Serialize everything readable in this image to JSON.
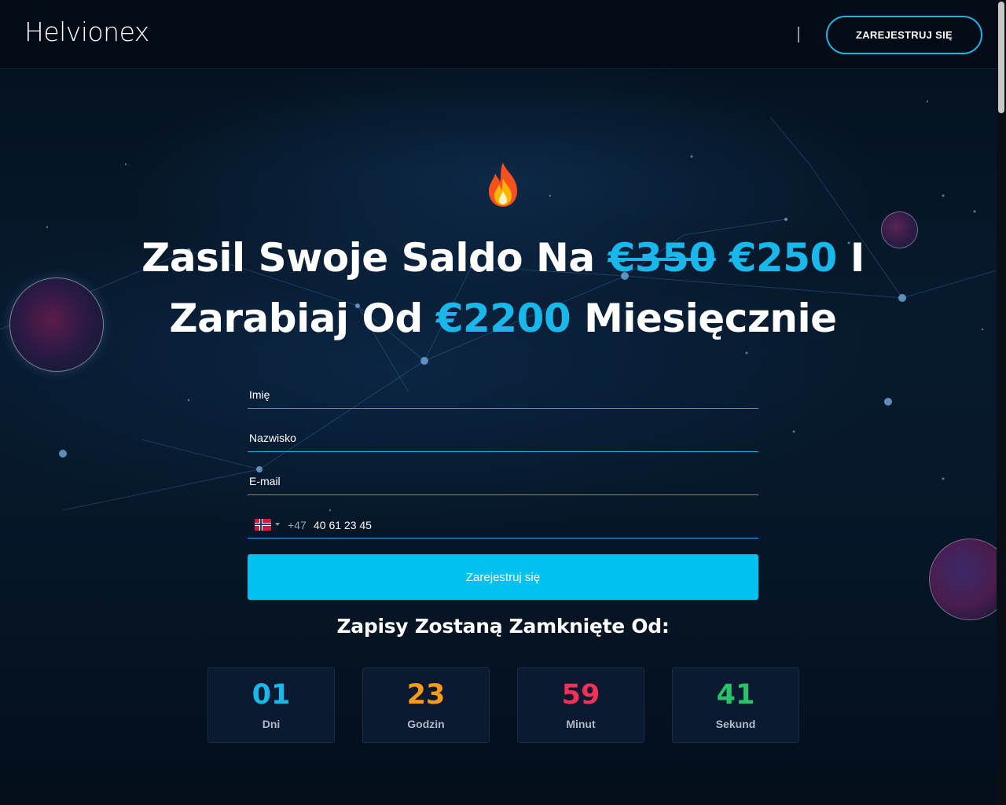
{
  "header": {
    "logo": "Helvionex",
    "cta_label": "ZAREJESTRUJ SIĘ"
  },
  "hero": {
    "icon": "fire-icon",
    "headline": {
      "part1": "Zasil Swoje Saldo Na ",
      "old_price": "€350",
      "space": " ",
      "new_price": "€250",
      "part2": " I Zarabiaj Od ",
      "income": "€2200",
      "part3": " Miesięcznie"
    }
  },
  "form": {
    "first_name_placeholder": "Imię",
    "last_name_placeholder": "Nazwisko",
    "email_placeholder": "E-mail",
    "phone": {
      "country_flag": "norway-flag",
      "dial_code": "+47",
      "value": "40 61 23 45"
    },
    "submit_label": "Zarejestruj się"
  },
  "countdown": {
    "title": "Zapisy Zostaną Zamknięte Od:",
    "units": [
      {
        "value": "01",
        "label": "Dni",
        "color": "#19b7ea"
      },
      {
        "value": "23",
        "label": "Godzin",
        "color": "#f29b1e"
      },
      {
        "value": "59",
        "label": "Minut",
        "color": "#f0325a"
      },
      {
        "value": "41",
        "label": "Sekund",
        "color": "#29c46a"
      }
    ]
  },
  "colors": {
    "accent": "#19b7ea",
    "button": "#00c2f0",
    "background": "#051120"
  }
}
